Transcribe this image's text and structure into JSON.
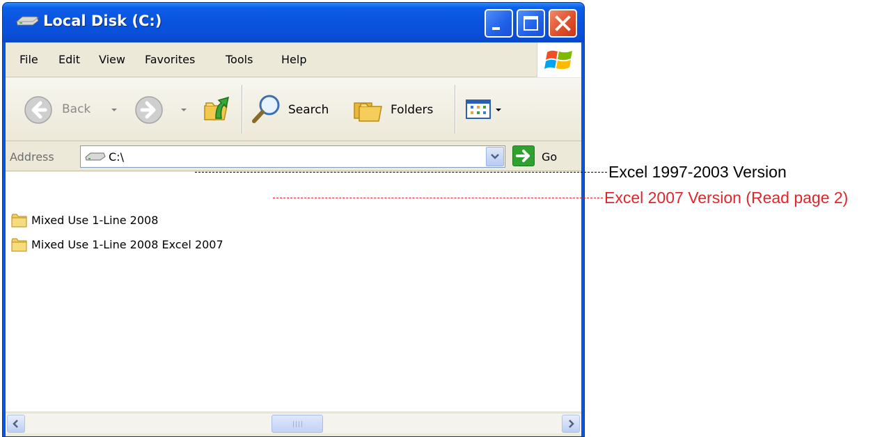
{
  "window": {
    "title": "Local Disk (C:)"
  },
  "menubar": {
    "items": [
      "File",
      "Edit",
      "View",
      "Favorites",
      "Tools",
      "Help"
    ]
  },
  "toolbar": {
    "back_label": "Back",
    "search_label": "Search",
    "folders_label": "Folders"
  },
  "address": {
    "label": "Address",
    "value": "C:\\",
    "go_label": "Go"
  },
  "files": [
    {
      "name": "Mixed Use 1-Line 2008"
    },
    {
      "name": "Mixed Use 1-Line 2008 Excel 2007"
    }
  ],
  "annotations": [
    {
      "text": "Excel 1997-2003 Version",
      "color": "#000000"
    },
    {
      "text": "Excel 2007 Version (Read page 2)",
      "color": "#e0262a"
    }
  ],
  "colors": {
    "titlebar": "#0a54df",
    "client_bg": "#ece9d8",
    "annotation_black": "#000000",
    "annotation_red": "#e0262a"
  },
  "icons": {
    "title": "drive-icon",
    "back": "back-arrow-icon",
    "forward": "forward-arrow-icon",
    "up": "folder-up-icon",
    "search": "magnifier-icon",
    "folders": "folders-icon",
    "views": "views-icon",
    "go": "go-arrow-icon",
    "file": "folder-icon"
  }
}
